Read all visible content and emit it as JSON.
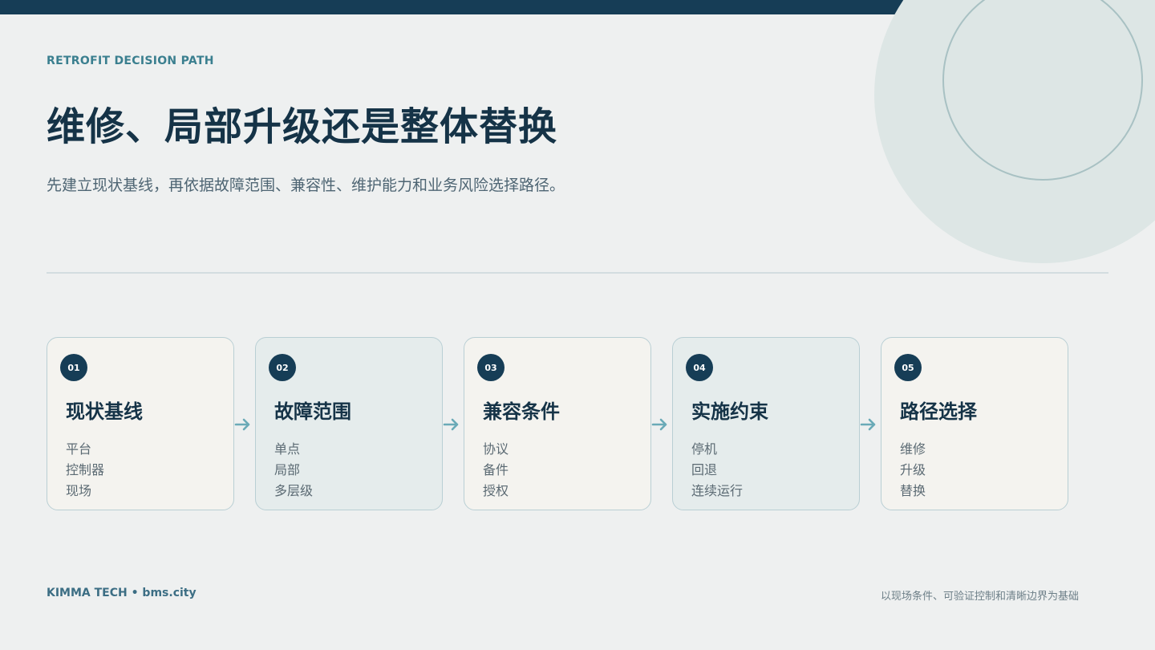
{
  "header": {
    "eyebrow": "RETROFIT DECISION PATH",
    "title": "维修、局部升级还是整体替换",
    "subtitle": "先建立现状基线，再依据故障范围、兼容性、维护能力和业务风险选择路径。"
  },
  "steps": [
    {
      "number": "01",
      "title": "现状基线",
      "items": [
        "平台",
        "控制器",
        "现场"
      ]
    },
    {
      "number": "02",
      "title": "故障范围",
      "items": [
        "单点",
        "局部",
        "多层级"
      ]
    },
    {
      "number": "03",
      "title": "兼容条件",
      "items": [
        "协议",
        "备件",
        "授权"
      ]
    },
    {
      "number": "04",
      "title": "实施约束",
      "items": [
        "停机",
        "回退",
        "连续运行"
      ]
    },
    {
      "number": "05",
      "title": "路径选择",
      "items": [
        "维修",
        "升级",
        "替换"
      ]
    }
  ],
  "footer": {
    "brand": "KIMMA TECH • bms.city",
    "note": "以现场条件、可验证控制和清晰边界为基础"
  },
  "colors": {
    "navy": "#163d56",
    "accent": "#3a7f8f",
    "arrow": "#6aaab7",
    "background": "#eef0f0"
  }
}
